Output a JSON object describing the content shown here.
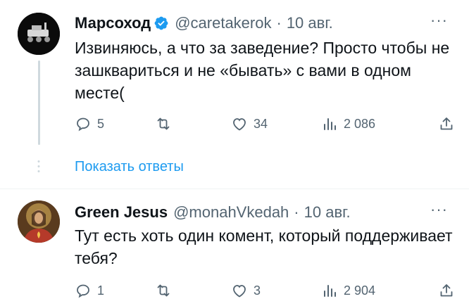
{
  "tweets": [
    {
      "name": "Марсоход",
      "handle": "@caretakerok",
      "separator": "·",
      "date": "10 авг.",
      "more": "···",
      "text": "Извиняюсь, а что за заведение? Просто чтобы не зашквариться и не «бывать» с вами в одном месте(",
      "replies": "5",
      "retweets": "",
      "likes": "34",
      "views": "2 086",
      "show_replies": "Показать ответы",
      "verified": true
    },
    {
      "name": "Green Jesus",
      "handle": "@monahVkedah",
      "separator": "·",
      "date": "10 авг.",
      "more": "···",
      "text": "Тут есть хоть один комент, который поддерживает тебя?",
      "replies": "1",
      "retweets": "",
      "likes": "3",
      "views": "2 904",
      "verified": false
    }
  ],
  "colors": {
    "accent": "#1d9bf0",
    "muted": "#536471",
    "text": "#0f1419"
  },
  "icons": [
    "reply-icon",
    "retweet-icon",
    "like-icon",
    "views-icon",
    "share-icon",
    "verified-icon",
    "more-icon"
  ]
}
